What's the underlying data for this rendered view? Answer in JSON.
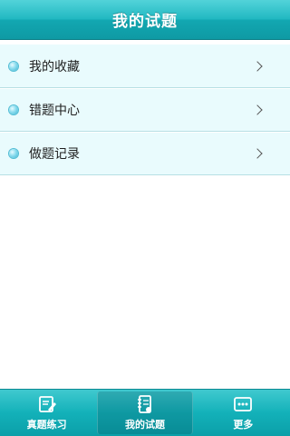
{
  "header": {
    "title": "我的试题"
  },
  "list": {
    "items": [
      {
        "label": "我的收藏",
        "icon": "bullet-icon",
        "action_icon": "chevron-right-icon"
      },
      {
        "label": "错题中心",
        "icon": "bullet-icon",
        "action_icon": "chevron-right-icon"
      },
      {
        "label": "做题记录",
        "icon": "bullet-icon",
        "action_icon": "chevron-right-icon"
      }
    ]
  },
  "tabbar": {
    "tabs": [
      {
        "label": "真题练习",
        "icon": "pencil-note-icon",
        "active": false
      },
      {
        "label": "我的试题",
        "icon": "notebook-icon",
        "active": true
      },
      {
        "label": "更多",
        "icon": "more-dots-icon",
        "active": false
      }
    ]
  },
  "colors": {
    "header_gradient_top": "#52d3d9",
    "header_gradient_bottom": "#0f9aa4",
    "row_background": "#e9fbfd",
    "row_divider": "#b7dfe4",
    "tabbar_background": "#13b1b9"
  }
}
